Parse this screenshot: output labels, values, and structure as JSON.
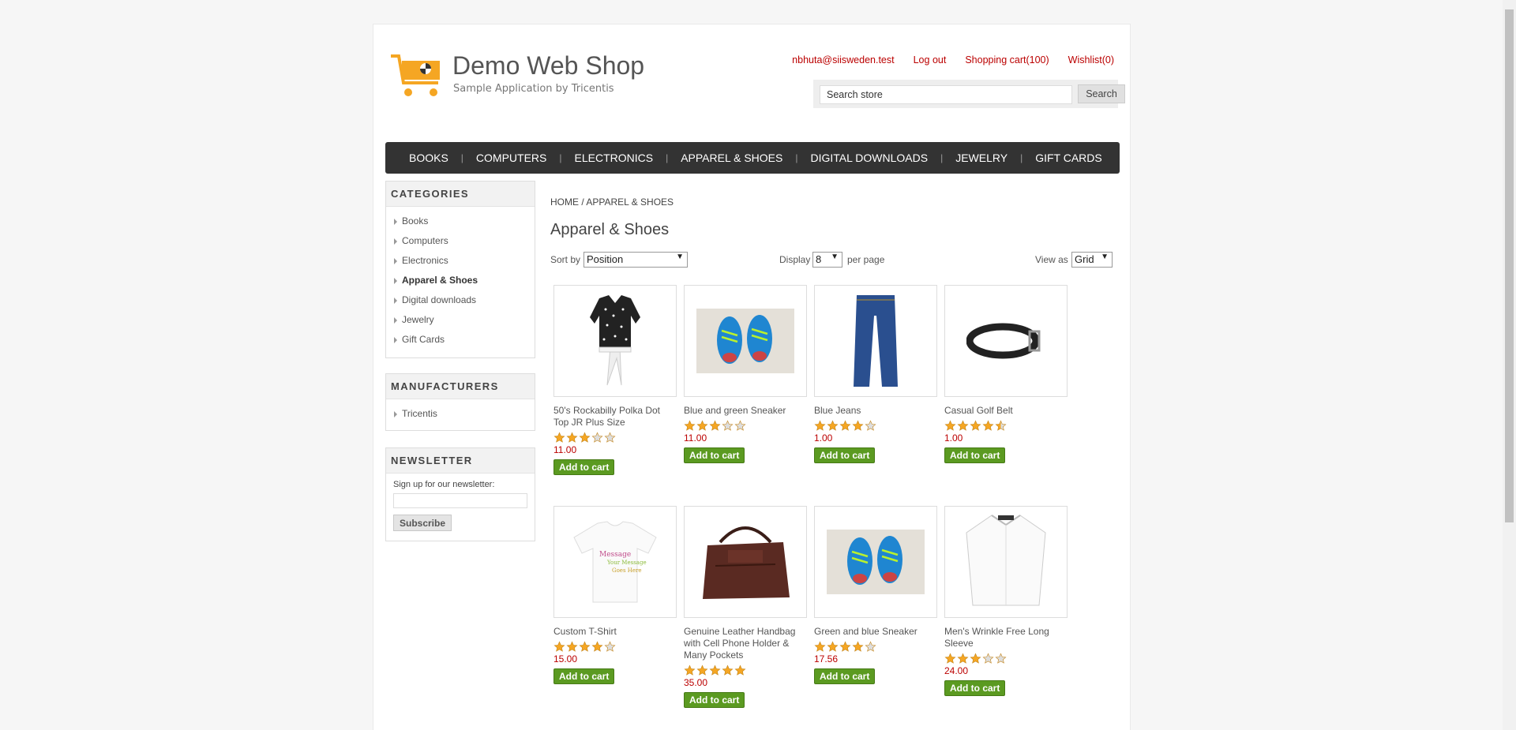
{
  "header": {
    "title": "Demo Web Shop",
    "subtitle": "Sample Application by Tricentis",
    "links": [
      "nbhuta@siisweden.test",
      "Log out",
      "Shopping cart(100)",
      "Wishlist(0)"
    ],
    "search_placeholder": "Search store",
    "search_button": "Search"
  },
  "menu": [
    "BOOKS",
    "COMPUTERS",
    "ELECTRONICS",
    "APPAREL & SHOES",
    "DIGITAL DOWNLOADS",
    "JEWELRY",
    "GIFT CARDS"
  ],
  "categories": {
    "title": "CATEGORIES",
    "items": [
      "Books",
      "Computers",
      "Electronics",
      "Apparel & Shoes",
      "Digital downloads",
      "Jewelry",
      "Gift Cards"
    ]
  },
  "manufacturers": {
    "title": "MANUFACTURERS",
    "items": [
      "Tricentis"
    ]
  },
  "newsletter": {
    "title": "NEWSLETTER",
    "label": "Sign up for our newsletter:",
    "button": "Subscribe"
  },
  "breadcrumb": "HOME / APPAREL & SHOES",
  "page_title": "Apparel & Shoes",
  "controls": {
    "sort_label": "Sort by",
    "sort_value": "Position",
    "display_label": "Display",
    "display_value": "8",
    "per_page": "per page",
    "view_label": "View as",
    "view_value": "Grid"
  },
  "add_to_cart": "Add to cart",
  "products": [
    {
      "title": "50's Rockabilly Polka Dot Top JR Plus Size",
      "rating": 3,
      "price": "11.00",
      "icon": "polka-top"
    },
    {
      "title": "Blue and green Sneaker",
      "rating": 3,
      "price": "11.00",
      "icon": "sneaker"
    },
    {
      "title": "Blue Jeans",
      "rating": 4,
      "price": "1.00",
      "icon": "jeans"
    },
    {
      "title": "Casual Golf Belt",
      "rating": 4.5,
      "price": "1.00",
      "icon": "belt"
    },
    {
      "title": "Custom T-Shirt",
      "rating": 4,
      "price": "15.00",
      "icon": "tshirt"
    },
    {
      "title": "Genuine Leather Handbag with Cell Phone Holder & Many Pockets",
      "rating": 5,
      "price": "35.00",
      "icon": "handbag"
    },
    {
      "title": "Green and blue Sneaker",
      "rating": 4,
      "price": "17.56",
      "icon": "sneaker"
    },
    {
      "title": "Men's Wrinkle Free Long Sleeve",
      "rating": 3,
      "price": "24.00",
      "icon": "shirt"
    }
  ]
}
